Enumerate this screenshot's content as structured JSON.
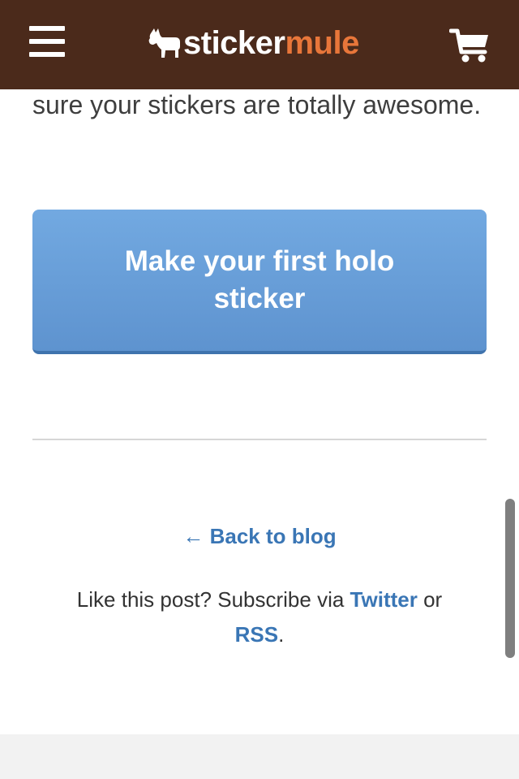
{
  "header": {
    "brand_part1": "sticker",
    "brand_part2": "mule",
    "menu_icon": "hamburger-menu-icon",
    "cart_icon": "cart-icon",
    "logo_icon": "mule-icon",
    "background_color": "#4b2a1b",
    "brand_accent_color": "#e8763a"
  },
  "content": {
    "intro_text": "sure your stickers are totally awesome.",
    "cta_label": "Make your first holo sticker",
    "cta_color": "#6a9fd9"
  },
  "footer": {
    "back_arrow": "←",
    "back_label": "Back to blog",
    "subscribe_prefix": "Like this post? Subscribe via",
    "twitter_label": "Twitter",
    "or_text": "or",
    "rss_label": "RSS",
    "period": "."
  }
}
